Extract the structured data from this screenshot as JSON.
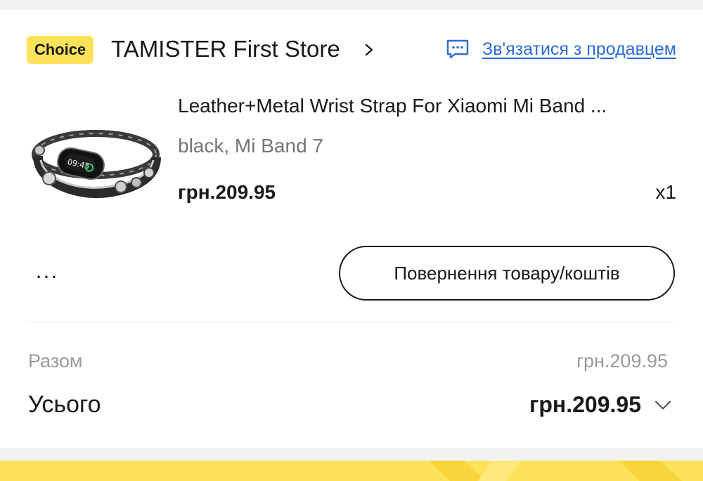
{
  "store": {
    "badge": "Choice",
    "name": "TAMISTER First Store",
    "contact_label": "Зв'язатися з продавцем",
    "chevron_icon": "chevron-right-icon",
    "chat_icon": "chat-bubble-icon"
  },
  "product": {
    "title": "Leather+Metal Wrist Strap For Xiaomi Mi Band ...",
    "variant": "black, Mi Band 7",
    "price": "грн.209.95",
    "quantity": "x1",
    "image_icon": "wrist-strap-product-image",
    "watch_time": "09:45"
  },
  "actions": {
    "more_label": "...",
    "return_label": "Повернення товару/коштів"
  },
  "summary": {
    "subtotal_label": "Разом",
    "subtotal_value": "грн.209.95",
    "total_label": "Усього",
    "total_value": "грн.209.95",
    "expand_icon": "chevron-down-icon"
  },
  "colors": {
    "choice_badge": "#fde25a",
    "link": "#2b6cd6",
    "text": "#191919",
    "muted": "#9a9a9a",
    "page_bg": "#f2f2f2"
  }
}
